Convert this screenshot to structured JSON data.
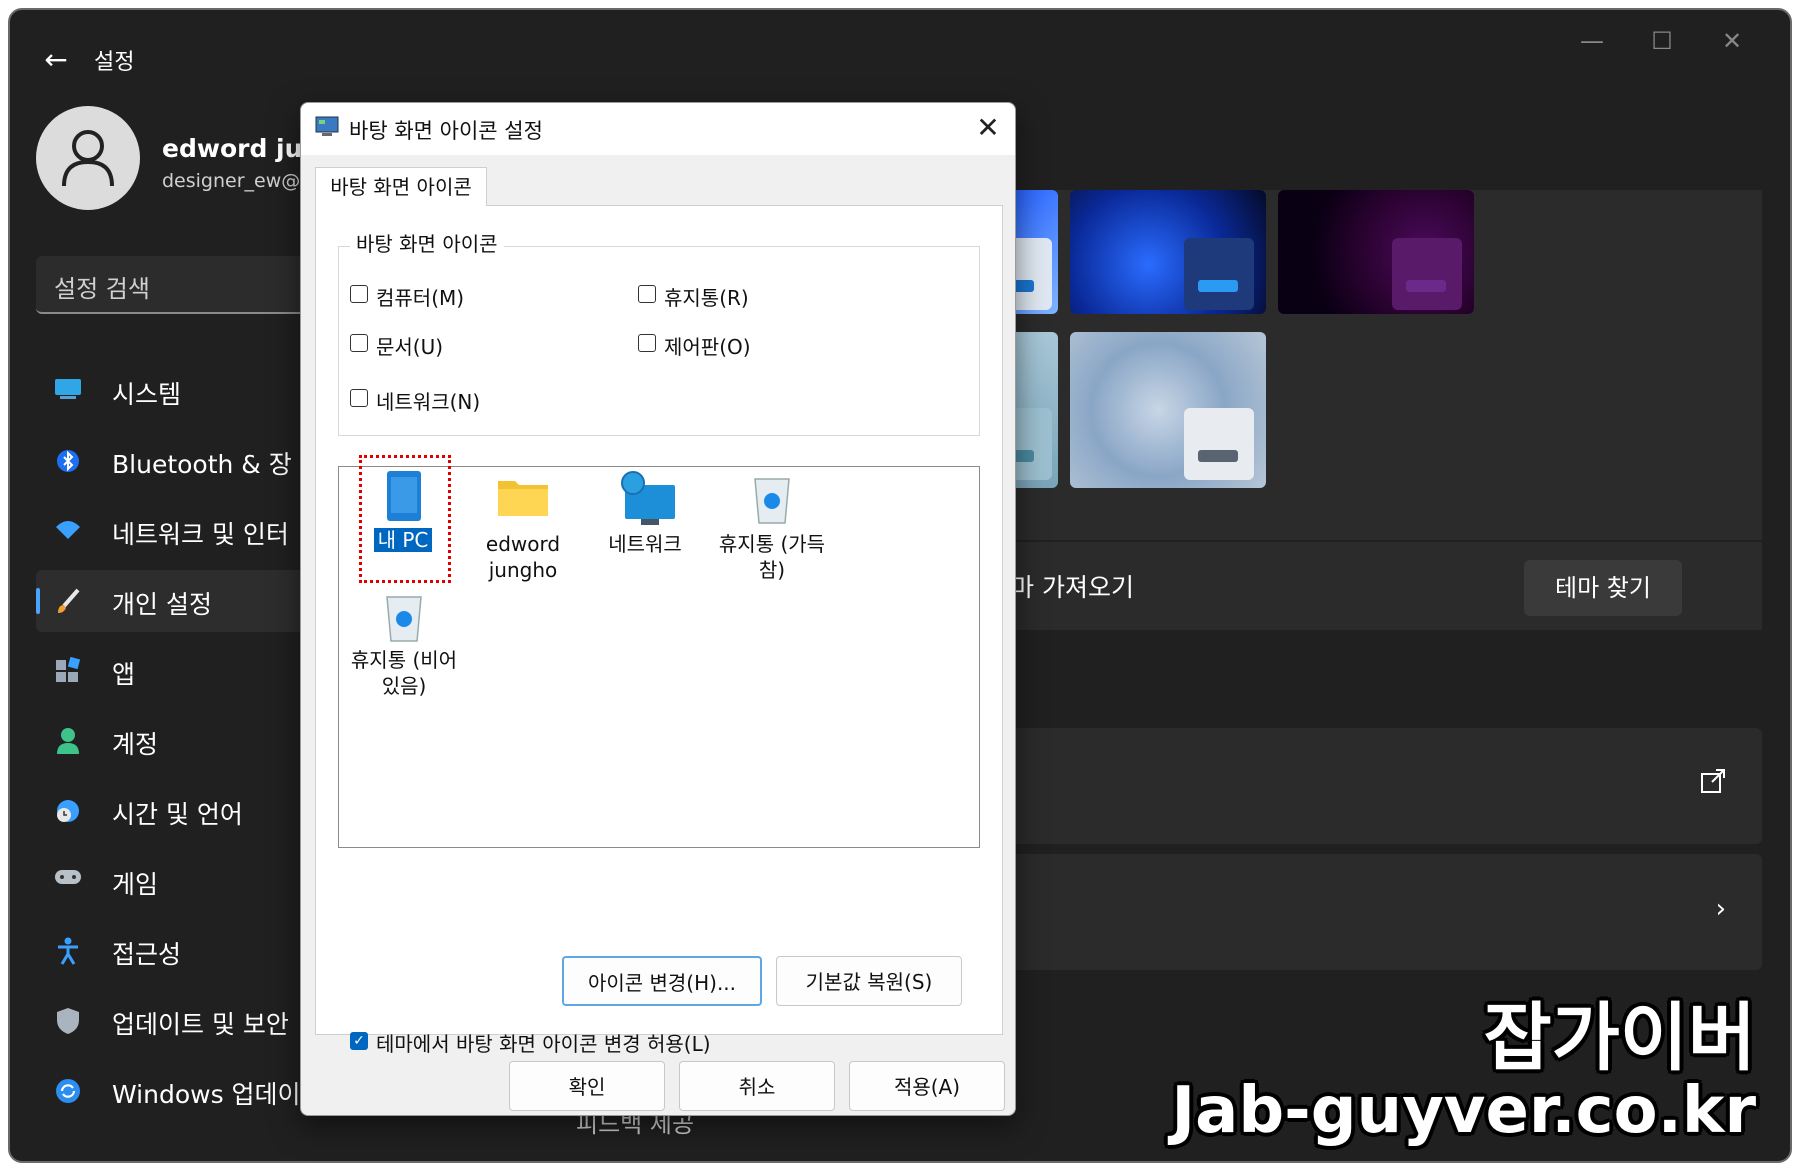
{
  "window": {
    "title": "설정",
    "colors": {
      "background": "#202020",
      "accent": "#4aa3ff"
    }
  },
  "profile": {
    "name": "edword jung",
    "email": "designer_ew@"
  },
  "search": {
    "placeholder": "설정 검색"
  },
  "sidebar": {
    "items": [
      {
        "label": "시스템",
        "icon": "monitor-icon"
      },
      {
        "label": "Bluetooth & 장",
        "icon": "bluetooth-icon"
      },
      {
        "label": "네트워크 및 인터",
        "icon": "wifi-icon"
      },
      {
        "label": "개인 설정",
        "icon": "brush-icon",
        "active": true
      },
      {
        "label": "앱",
        "icon": "apps-icon"
      },
      {
        "label": "계정",
        "icon": "account-icon"
      },
      {
        "label": "시간 및 언어",
        "icon": "globe-clock-icon"
      },
      {
        "label": "게임",
        "icon": "gamepad-icon"
      },
      {
        "label": "접근성",
        "icon": "accessibility-icon"
      },
      {
        "label": "업데이트 및 보안",
        "icon": "shield-icon"
      },
      {
        "label": "Windows 업데이",
        "icon": "update-icon"
      }
    ]
  },
  "content": {
    "theme_import_label": "테마 가져오기",
    "find_themes_button": "테마 찾기",
    "feedback_label": "피드백 제공"
  },
  "dialog": {
    "title": "바탕 화면 아이콘 설정",
    "tab": "바탕 화면 아이콘",
    "group_label": "바탕 화면 아이콘",
    "checkboxes": [
      {
        "label": "컴퓨터(M)",
        "checked": false
      },
      {
        "label": "휴지통(R)",
        "checked": false
      },
      {
        "label": "문서(U)",
        "checked": false
      },
      {
        "label": "제어판(O)",
        "checked": false
      },
      {
        "label": "네트워크(N)",
        "checked": false
      }
    ],
    "icons": [
      {
        "label": "내 PC",
        "icon": "this-pc-icon",
        "selected": true
      },
      {
        "label": "edword jungho",
        "icon": "user-folder-icon"
      },
      {
        "label": "네트워크",
        "icon": "network-icon"
      },
      {
        "label": "휴지통 (가득 참)",
        "icon": "recycle-bin-full-icon"
      },
      {
        "label": "휴지통 (비어 있음)",
        "icon": "recycle-bin-empty-icon"
      }
    ],
    "change_icon_button": "아이콘 변경(H)...",
    "restore_default_button": "기본값 복원(S)",
    "allow_theme_checkbox": {
      "label": "테마에서 바탕 화면 아이콘 변경 허용(L)",
      "checked": true
    },
    "ok_button": "확인",
    "cancel_button": "취소",
    "apply_button": "적용(A)"
  },
  "watermark": {
    "title": "잡가이버",
    "url": "Jab-guyver.co.kr"
  }
}
